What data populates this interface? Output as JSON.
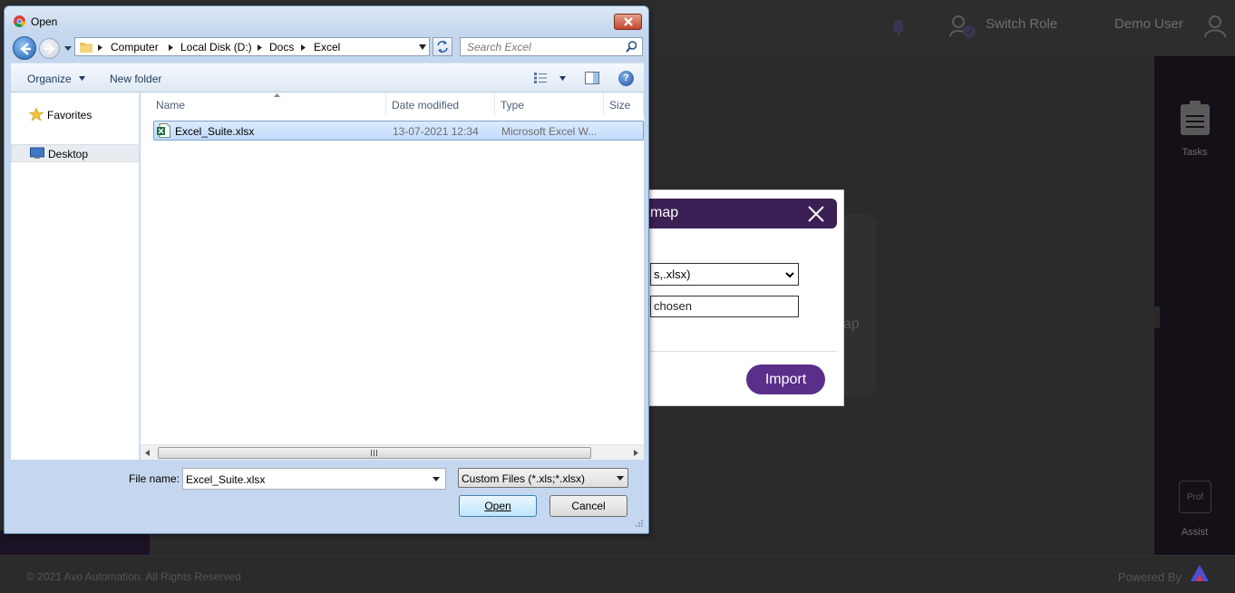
{
  "app": {
    "header": {
      "switch_role_label": "Switch Role",
      "user_label": "Demo User"
    },
    "right_rail": {
      "tasks_label": "Tasks",
      "assist_label": "Assist",
      "assist_icon_text": "Prof"
    },
    "card_partial_text": "ap",
    "footer": {
      "copyright": "© 2021 Avo Automation. All Rights Reserved",
      "powered_by": "Powered By"
    }
  },
  "modal": {
    "title_partial": "map",
    "file_type_partial": "s,.xlsx)",
    "file_chosen_partial": "chosen",
    "import_label": "Import",
    "accent_color": "#3b2056",
    "button_color": "#5a2f8a"
  },
  "dialog": {
    "title": "Open",
    "breadcrumb": [
      "Computer",
      "Local Disk (D:)",
      "Docs",
      "Excel"
    ],
    "search_placeholder": "Search Excel",
    "toolbar": {
      "organize_label": "Organize",
      "new_folder_label": "New folder",
      "help_glyph": "?"
    },
    "nav": {
      "favorites_label": "Favorites",
      "desktop_label": "Desktop"
    },
    "columns": {
      "name": "Name",
      "date_modified": "Date modified",
      "type": "Type",
      "size": "Size"
    },
    "files": [
      {
        "name": "Excel_Suite.xlsx",
        "date_modified": "13-07-2021 12:34",
        "type": "Microsoft Excel W...",
        "size": ""
      }
    ],
    "file_name_label": "File name:",
    "file_name_value": "Excel_Suite.xlsx",
    "file_type_value": "Custom Files (*.xls;*.xlsx)",
    "open_button_label": "Open",
    "cancel_button_label": "Cancel"
  }
}
